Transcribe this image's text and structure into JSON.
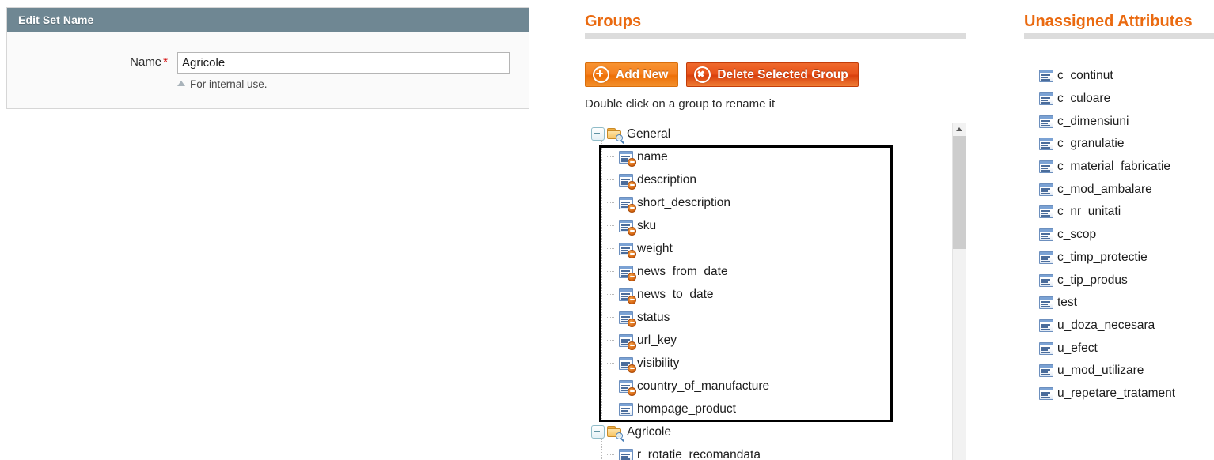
{
  "edit_set": {
    "panel_title": "Edit Set Name",
    "name_label": "Name",
    "required_marker": "*",
    "name_value": "Agricole",
    "name_placeholder": "",
    "note": "For internal use."
  },
  "groups": {
    "title": "Groups",
    "add_new_label": "Add New",
    "delete_group_label": "Delete Selected Group",
    "hint": "Double click on a group to rename it",
    "tree": [
      {
        "name": "General",
        "type": "group",
        "expanded": true,
        "selected_children": true,
        "children": [
          {
            "name": "name",
            "system": true
          },
          {
            "name": "description",
            "system": true
          },
          {
            "name": "short_description",
            "system": true
          },
          {
            "name": "sku",
            "system": true
          },
          {
            "name": "weight",
            "system": true
          },
          {
            "name": "news_from_date",
            "system": true
          },
          {
            "name": "news_to_date",
            "system": true
          },
          {
            "name": "status",
            "system": true
          },
          {
            "name": "url_key",
            "system": true
          },
          {
            "name": "visibility",
            "system": true
          },
          {
            "name": "country_of_manufacture",
            "system": true
          },
          {
            "name": "hompage_product",
            "system": false
          }
        ]
      },
      {
        "name": "Agricole",
        "type": "group",
        "expanded": true,
        "selected_children": false,
        "children": [
          {
            "name": "r_rotatie_recomandata",
            "system": false
          }
        ]
      }
    ]
  },
  "unassigned": {
    "title": "Unassigned Attributes",
    "items": [
      "c_continut",
      "c_culoare",
      "c_dimensiuni",
      "c_granulatie",
      "c_material_fabricatie",
      "c_mod_ambalare",
      "c_nr_unitati",
      "c_scop",
      "c_timp_protectie",
      "c_tip_produs",
      "test",
      "u_doza_necesara",
      "u_efect",
      "u_mod_utilizare",
      "u_repetare_tratament"
    ]
  },
  "colors": {
    "heading_orange": "#ea6a10",
    "panel_header": "#6f8793",
    "required_red": "#d40707",
    "button_add": "#f58020",
    "button_delete": "#e8531b",
    "selection_outline": "#000000",
    "rule_gray": "#dcdcdc"
  }
}
